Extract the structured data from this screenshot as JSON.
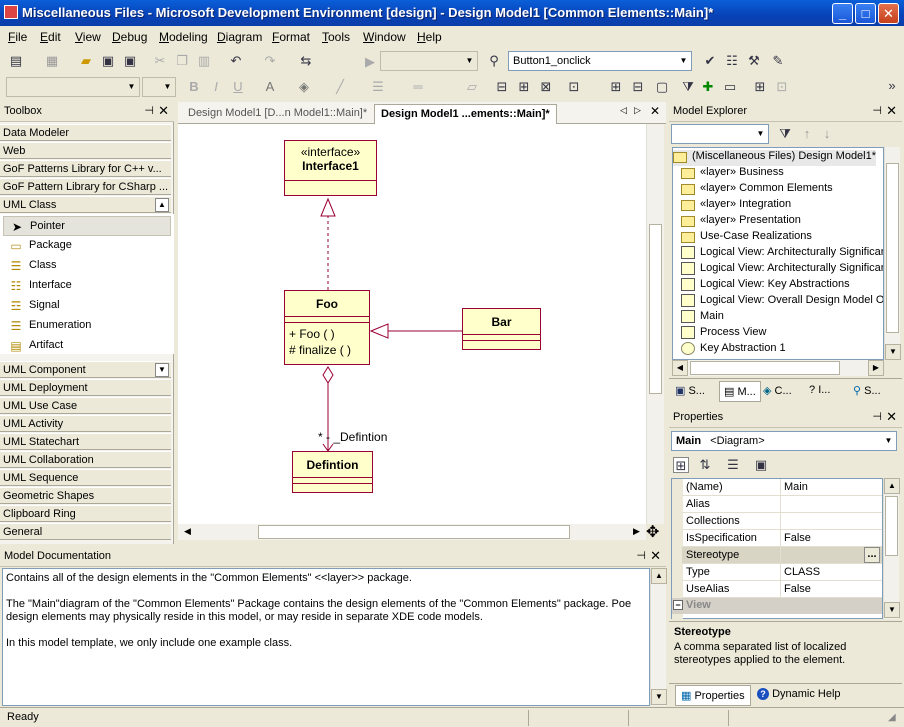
{
  "window": {
    "title": "Miscellaneous Files - Microsoft Development Environment [design] - Design Model1 [Common Elements::Main]*",
    "min": "_",
    "max": "□",
    "close": "✕"
  },
  "menu": [
    "File",
    "Edit",
    "View",
    "Debug",
    "Modeling",
    "Diagram",
    "Format",
    "Tools",
    "Window",
    "Help"
  ],
  "toolbar": {
    "config_combo": "",
    "function_combo": "Button1_onclick"
  },
  "toolbox": {
    "title": "Toolbox",
    "top_categories": [
      "Data Modeler",
      "Web",
      "GoF Patterns Library for C++ v...",
      "GoF Pattern Library for CSharp ...",
      "UML Class"
    ],
    "items": [
      {
        "label": "Pointer",
        "icon": "pointer-icon",
        "glyph": "➤"
      },
      {
        "label": "Package",
        "icon": "package-icon",
        "glyph": "▭"
      },
      {
        "label": "Class",
        "icon": "class-icon",
        "glyph": "☰"
      },
      {
        "label": "Interface",
        "icon": "interface-icon",
        "glyph": "☷"
      },
      {
        "label": "Signal",
        "icon": "signal-icon",
        "glyph": "☲"
      },
      {
        "label": "Enumeration",
        "icon": "enumeration-icon",
        "glyph": "☰"
      },
      {
        "label": "Artifact",
        "icon": "artifact-icon",
        "glyph": "▤"
      }
    ],
    "bottom_categories": [
      "UML Component",
      "UML Deployment",
      "UML Use Case",
      "UML Activity",
      "UML Statechart",
      "UML Collaboration",
      "UML Sequence",
      "Geometric Shapes",
      "Clipboard Ring",
      "General"
    ]
  },
  "tabs": [
    {
      "label": "Design Model1 [D...n Model1::Main]*",
      "active": false
    },
    {
      "label": "Design Model1 ...ements::Main]*",
      "active": true
    }
  ],
  "diagram": {
    "interface": {
      "stereotype": "«interface»",
      "name": "Interface1"
    },
    "foo": {
      "name": "Foo",
      "op1": "+ Foo (  )",
      "op2": "# finalize (  )"
    },
    "bar": {
      "name": "Bar"
    },
    "defintion": {
      "name": "Defintion"
    },
    "assoc_label": "* - _Defintion"
  },
  "model_explorer": {
    "title": "Model Explorer",
    "root": "(Miscellaneous Files) Design Model1*",
    "nodes": [
      {
        "label": "«layer» Business",
        "type": "folder"
      },
      {
        "label": "«layer» Common Elements",
        "type": "folder"
      },
      {
        "label": "«layer» Integration",
        "type": "folder"
      },
      {
        "label": "«layer» Presentation",
        "type": "folder"
      },
      {
        "label": "Use-Case Realizations",
        "type": "folder"
      },
      {
        "label": "Logical View: Architecturally Significant",
        "type": "diagram"
      },
      {
        "label": "Logical View: Architecturally Significant",
        "type": "diagram"
      },
      {
        "label": "Logical View: Key Abstractions",
        "type": "diagram"
      },
      {
        "label": "Logical View: Overall Design Model Org",
        "type": "diagram"
      },
      {
        "label": "Main",
        "type": "diagram"
      },
      {
        "label": "Process View",
        "type": "diagram"
      },
      {
        "label": "Key Abstraction 1",
        "type": "circle"
      }
    ],
    "bottom_tabs": [
      "S...",
      "M...",
      "C...",
      "I...",
      "S..."
    ]
  },
  "properties": {
    "title": "Properties",
    "object": "Main",
    "object_type": "<Diagram>",
    "rows": [
      {
        "key": "(Name)",
        "value": "Main"
      },
      {
        "key": "Alias",
        "value": ""
      },
      {
        "key": "Collections",
        "value": ""
      },
      {
        "key": "IsSpecification",
        "value": "False"
      },
      {
        "key": "Stereotype",
        "value": ""
      },
      {
        "key": "Type",
        "value": "CLASS"
      },
      {
        "key": "UseAlias",
        "value": "False"
      }
    ],
    "category": "View",
    "desc_title": "Stereotype",
    "desc_text": "A comma separated list of localized stereotypes applied to the element.",
    "tab_properties": "Properties",
    "tab_help": "Dynamic Help"
  },
  "documentation": {
    "title": "Model Documentation",
    "lines": [
      "Contains all of the design elements in the \"Common Elements\" <<layer>> package.",
      "",
      "The \"Main\"diagram of the \"Common Elements\" Package contains the design elements of the \"Common Elements\" package.  Poe",
      "design elements may physically reside in this model, or may reside in separate XDE code models.",
      "",
      "In this model template, we only include one example class."
    ]
  },
  "status": {
    "text": "Ready"
  }
}
